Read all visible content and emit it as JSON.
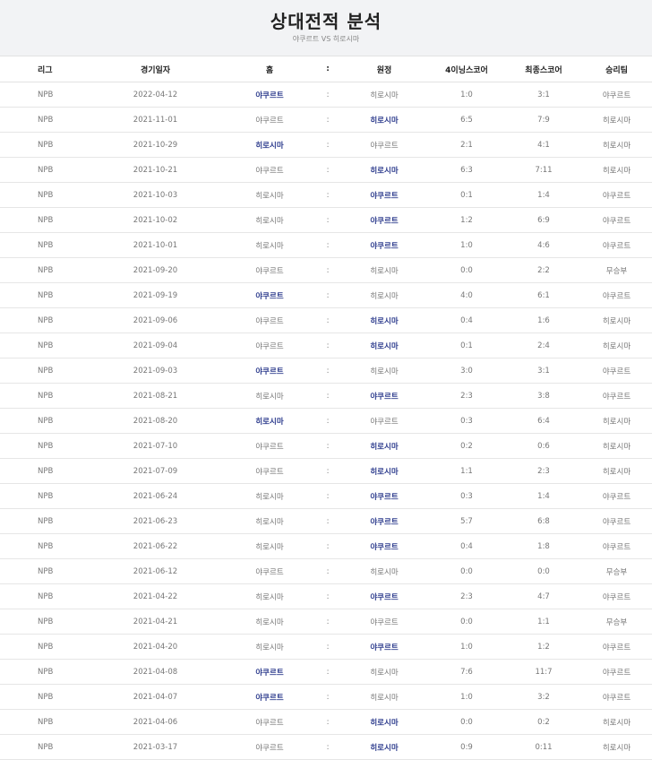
{
  "header": {
    "title": "상대전적 분석",
    "subtitle": "야쿠르트 VS 히로시마"
  },
  "columns": [
    "리그",
    "경기일자",
    "홈",
    ":",
    "원정",
    "4이닝스코어",
    "최종스코어",
    "승리팀"
  ],
  "colors": {
    "winner": "#2b3a8c",
    "header_bg": "#f2f3f5"
  },
  "rows": [
    {
      "league": "NPB",
      "date": "2022-04-12",
      "home": "야쿠르트",
      "sep": ":",
      "away": "히로시마",
      "score4": "1:0",
      "final": "3:1",
      "winner": "야쿠르트",
      "win_side": "home"
    },
    {
      "league": "NPB",
      "date": "2021-11-01",
      "home": "야쿠르트",
      "sep": ":",
      "away": "히로시마",
      "score4": "6:5",
      "final": "7:9",
      "winner": "히로시마",
      "win_side": "away"
    },
    {
      "league": "NPB",
      "date": "2021-10-29",
      "home": "히로시마",
      "sep": ":",
      "away": "야쿠르트",
      "score4": "2:1",
      "final": "4:1",
      "winner": "히로시마",
      "win_side": "home"
    },
    {
      "league": "NPB",
      "date": "2021-10-21",
      "home": "야쿠르트",
      "sep": ":",
      "away": "히로시마",
      "score4": "6:3",
      "final": "7:11",
      "winner": "히로시마",
      "win_side": "away"
    },
    {
      "league": "NPB",
      "date": "2021-10-03",
      "home": "히로시마",
      "sep": ":",
      "away": "야쿠르트",
      "score4": "0:1",
      "final": "1:4",
      "winner": "야쿠르트",
      "win_side": "away"
    },
    {
      "league": "NPB",
      "date": "2021-10-02",
      "home": "히로시마",
      "sep": ":",
      "away": "야쿠르트",
      "score4": "1:2",
      "final": "6:9",
      "winner": "야쿠르트",
      "win_side": "away"
    },
    {
      "league": "NPB",
      "date": "2021-10-01",
      "home": "히로시마",
      "sep": ":",
      "away": "야쿠르트",
      "score4": "1:0",
      "final": "4:6",
      "winner": "야쿠르트",
      "win_side": "away"
    },
    {
      "league": "NPB",
      "date": "2021-09-20",
      "home": "야쿠르트",
      "sep": ":",
      "away": "히로시마",
      "score4": "0:0",
      "final": "2:2",
      "winner": "무승부",
      "win_side": "none"
    },
    {
      "league": "NPB",
      "date": "2021-09-19",
      "home": "야쿠르트",
      "sep": ":",
      "away": "히로시마",
      "score4": "4:0",
      "final": "6:1",
      "winner": "야쿠르트",
      "win_side": "home"
    },
    {
      "league": "NPB",
      "date": "2021-09-06",
      "home": "야쿠르트",
      "sep": ":",
      "away": "히로시마",
      "score4": "0:4",
      "final": "1:6",
      "winner": "히로시마",
      "win_side": "away"
    },
    {
      "league": "NPB",
      "date": "2021-09-04",
      "home": "야쿠르트",
      "sep": ":",
      "away": "히로시마",
      "score4": "0:1",
      "final": "2:4",
      "winner": "히로시마",
      "win_side": "away"
    },
    {
      "league": "NPB",
      "date": "2021-09-03",
      "home": "야쿠르트",
      "sep": ":",
      "away": "히로시마",
      "score4": "3:0",
      "final": "3:1",
      "winner": "야쿠르트",
      "win_side": "home"
    },
    {
      "league": "NPB",
      "date": "2021-08-21",
      "home": "히로시마",
      "sep": ":",
      "away": "야쿠르트",
      "score4": "2:3",
      "final": "3:8",
      "winner": "야쿠르트",
      "win_side": "away"
    },
    {
      "league": "NPB",
      "date": "2021-08-20",
      "home": "히로시마",
      "sep": ":",
      "away": "야쿠르트",
      "score4": "0:3",
      "final": "6:4",
      "winner": "히로시마",
      "win_side": "home"
    },
    {
      "league": "NPB",
      "date": "2021-07-10",
      "home": "야쿠르트",
      "sep": ":",
      "away": "히로시마",
      "score4": "0:2",
      "final": "0:6",
      "winner": "히로시마",
      "win_side": "away"
    },
    {
      "league": "NPB",
      "date": "2021-07-09",
      "home": "야쿠르트",
      "sep": ":",
      "away": "히로시마",
      "score4": "1:1",
      "final": "2:3",
      "winner": "히로시마",
      "win_side": "away"
    },
    {
      "league": "NPB",
      "date": "2021-06-24",
      "home": "히로시마",
      "sep": ":",
      "away": "야쿠르트",
      "score4": "0:3",
      "final": "1:4",
      "winner": "야쿠르트",
      "win_side": "away"
    },
    {
      "league": "NPB",
      "date": "2021-06-23",
      "home": "히로시마",
      "sep": ":",
      "away": "야쿠르트",
      "score4": "5:7",
      "final": "6:8",
      "winner": "야쿠르트",
      "win_side": "away"
    },
    {
      "league": "NPB",
      "date": "2021-06-22",
      "home": "히로시마",
      "sep": ":",
      "away": "야쿠르트",
      "score4": "0:4",
      "final": "1:8",
      "winner": "야쿠르트",
      "win_side": "away"
    },
    {
      "league": "NPB",
      "date": "2021-06-12",
      "home": "야쿠르트",
      "sep": ":",
      "away": "히로시마",
      "score4": "0:0",
      "final": "0:0",
      "winner": "무승부",
      "win_side": "none"
    },
    {
      "league": "NPB",
      "date": "2021-04-22",
      "home": "히로시마",
      "sep": ":",
      "away": "야쿠르트",
      "score4": "2:3",
      "final": "4:7",
      "winner": "야쿠르트",
      "win_side": "away"
    },
    {
      "league": "NPB",
      "date": "2021-04-21",
      "home": "히로시마",
      "sep": ":",
      "away": "야쿠르트",
      "score4": "0:0",
      "final": "1:1",
      "winner": "무승부",
      "win_side": "none"
    },
    {
      "league": "NPB",
      "date": "2021-04-20",
      "home": "히로시마",
      "sep": ":",
      "away": "야쿠르트",
      "score4": "1:0",
      "final": "1:2",
      "winner": "야쿠르트",
      "win_side": "away"
    },
    {
      "league": "NPB",
      "date": "2021-04-08",
      "home": "야쿠르트",
      "sep": ":",
      "away": "히로시마",
      "score4": "7:6",
      "final": "11:7",
      "winner": "야쿠르트",
      "win_side": "home"
    },
    {
      "league": "NPB",
      "date": "2021-04-07",
      "home": "야쿠르트",
      "sep": ":",
      "away": "히로시마",
      "score4": "1:0",
      "final": "3:2",
      "winner": "야쿠르트",
      "win_side": "home"
    },
    {
      "league": "NPB",
      "date": "2021-04-06",
      "home": "야쿠르트",
      "sep": ":",
      "away": "히로시마",
      "score4": "0:0",
      "final": "0:2",
      "winner": "히로시마",
      "win_side": "away"
    },
    {
      "league": "NPB",
      "date": "2021-03-17",
      "home": "야쿠르트",
      "sep": ":",
      "away": "히로시마",
      "score4": "0:9",
      "final": "0:11",
      "winner": "히로시마",
      "win_side": "away"
    }
  ]
}
